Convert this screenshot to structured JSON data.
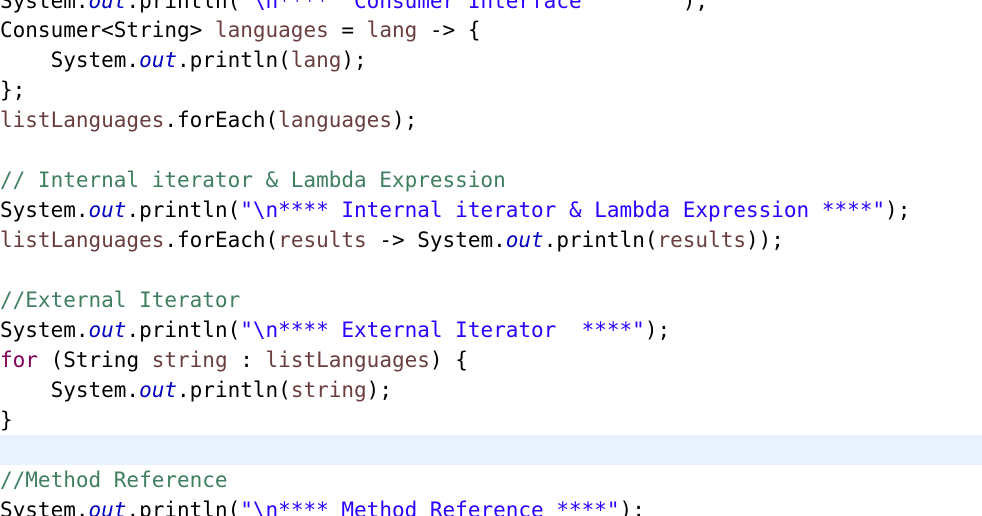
{
  "code": {
    "line0": {
      "a": "System.",
      "b": "out",
      "c": ".println(",
      "d": "\"\\n****  Consumer Interface       \"",
      "e": ");"
    },
    "line1": {
      "a": "Consumer<String> ",
      "b": "languages",
      "c": " = ",
      "d": "lang",
      "e": " -> {"
    },
    "line2": {
      "a": "    System.",
      "b": "out",
      "c": ".println(",
      "d": "lang",
      "e": ");"
    },
    "line3": {
      "a": "};"
    },
    "line4": {
      "a": "listLanguages",
      "b": ".forEach(",
      "c": "languages",
      "d": ");"
    },
    "line6": {
      "a": "// Internal iterator & Lambda Expression"
    },
    "line7": {
      "a": "System.",
      "b": "out",
      "c": ".println(",
      "d": "\"\\n**** Internal iterator & Lambda Expression ****\"",
      "e": ");"
    },
    "line8": {
      "a": "listLanguages",
      "b": ".forEach(",
      "c": "results",
      "d": " -> System.",
      "e": "out",
      "f": ".println(",
      "g": "results",
      "h": "));"
    },
    "line10": {
      "a": "//External Iterator"
    },
    "line11": {
      "a": "System.",
      "b": "out",
      "c": ".println(",
      "d": "\"\\n**** External Iterator  ****\"",
      "e": ");"
    },
    "line12": {
      "a": "for",
      "b": " (String ",
      "c": "string",
      "d": " : ",
      "e": "listLanguages",
      "f": ") {"
    },
    "line13": {
      "a": "    System.",
      "b": "out",
      "c": ".println(",
      "d": "string",
      "e": ");"
    },
    "line14": {
      "a": "}"
    },
    "line16": {
      "a": "//Method Reference"
    },
    "line17": {
      "a": "System.",
      "b": "out",
      "c": ".println(",
      "d": "\"\\n**** Method Reference ****\"",
      "e": ");"
    }
  }
}
